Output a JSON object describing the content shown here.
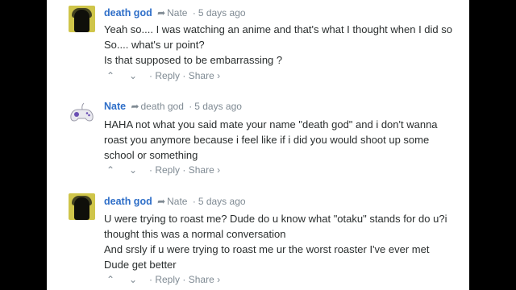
{
  "comments": [
    {
      "author": "death god",
      "reply_to": "Nate",
      "time": "5 days ago",
      "avatar": "death-god-avatar",
      "lines": [
        "Yeah so.... I was watching an anime and that's what I thought when I did so",
        "So.... what's ur point?",
        "Is that supposed to be embarrassing ?"
      ],
      "reply_label": "Reply",
      "share_label": "Share ›"
    },
    {
      "author": "Nate",
      "reply_to": "death god",
      "time": "5 days ago",
      "avatar": "gamepad-avatar",
      "lines": [
        "HAHA not what you said mate your name \"death god\" and i don't wanna",
        "roast you anymore because i feel like if i did you would shoot up some",
        "school or something"
      ],
      "reply_label": "Reply",
      "share_label": "Share ›"
    },
    {
      "author": "death god",
      "reply_to": "Nate",
      "time": "5 days ago",
      "avatar": "death-god-avatar",
      "lines": [
        "U were trying to roast me? Dude do u know what \"otaku\" stands for do u?i",
        "thought this was a normal conversation",
        "And srsly if u were trying to roast me ur the worst roaster I've ever met",
        "Dude get better"
      ],
      "reply_label": "Reply",
      "share_label": "Share ›"
    }
  ],
  "icons": {
    "reply_to": "reply-arrow-icon",
    "upvote": "chevron-up-icon",
    "downvote": "chevron-down-icon"
  },
  "glyphs": {
    "arrow": "➦",
    "up": "⌃",
    "down": "⌄",
    "dot": "·"
  },
  "colors": {
    "author": "#2e6ec8",
    "meta": "#7f8a93",
    "text": "#2a2e2e",
    "letterbox": "#000000"
  }
}
